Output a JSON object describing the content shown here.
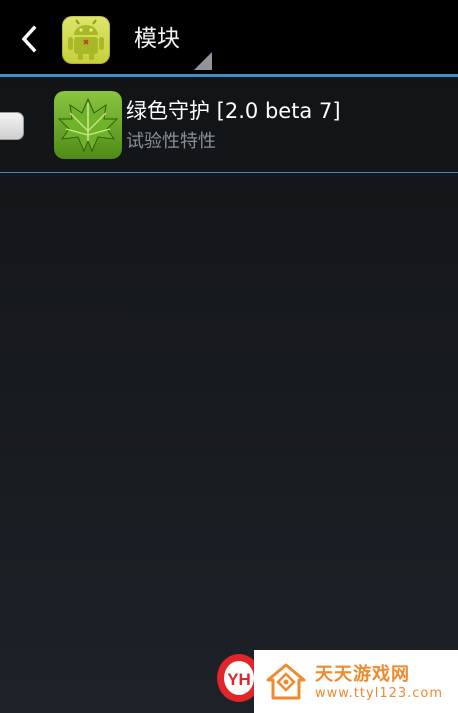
{
  "actionbar": {
    "title": "模块",
    "back_icon": "chevron-left-icon",
    "app_icon": "android-robot-icon"
  },
  "modules": [
    {
      "name": "绿色守护 [2.0 beta 7]",
      "description": "试验性特性",
      "icon": "green-leaf-icon",
      "enabled": false
    }
  ],
  "watermark": {
    "logo_text": "YH",
    "name": "天天游戏网",
    "url": "www.ttyl123.com"
  },
  "colors": {
    "divider": "#3b8fc4",
    "app_icon_bg": "#d4dc4e",
    "module_icon_bg": "#69a81f",
    "watermark_text": "#f08a2c",
    "watermark_logo": "#e0262a"
  }
}
